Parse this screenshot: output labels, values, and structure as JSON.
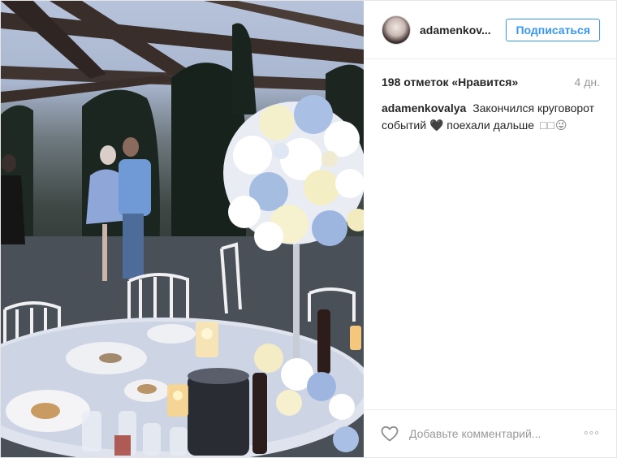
{
  "photo": {
    "alt": "",
    "sky_color": "#b4c1d8",
    "flower_colors": [
      "#ffffff",
      "#f6f0c8",
      "#9fb8e0"
    ]
  },
  "header": {
    "username": "adamenkov...",
    "follow_label": "Подписаться"
  },
  "meta": {
    "likes": "198 отметок «Нравится»",
    "time_ago": "4 дн."
  },
  "caption": {
    "username": "adamenkovalya",
    "text": "Закончился круговорот событий 🖤 поехали дальше",
    "trailing": "□□😜"
  },
  "footer": {
    "comment_placeholder": "Добавьте комментарий...",
    "more_label": "◦◦◦"
  },
  "colors": {
    "accent": "#3897f0",
    "text": "#262626",
    "muted": "#999999"
  }
}
